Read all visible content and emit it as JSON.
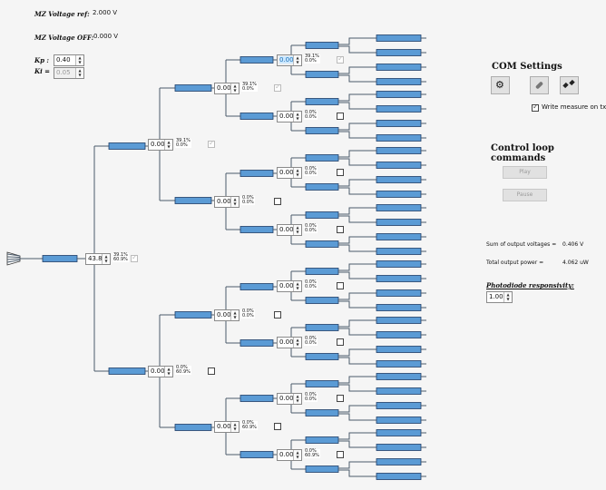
{
  "mz_ref": {
    "label": "MZ Voltage ref:",
    "value": "2.000 V"
  },
  "mz_off": {
    "label": "MZ Voltage OFF:",
    "value": "0.000 V"
  },
  "kp": {
    "label": "Kp :",
    "value": "0.40"
  },
  "ki": {
    "label": "Ki =",
    "value": "0.05"
  },
  "com": {
    "title": "COM Settings"
  },
  "write_measure": {
    "label": "Write measure on txt File",
    "checked": true
  },
  "control": {
    "title": "Control loop commands",
    "play": "Play",
    "pause": "Pause"
  },
  "sum_voltage": {
    "label": "Sum of output voltages =",
    "value": "0.406 V"
  },
  "total_power": {
    "label": "Total output power =",
    "value": "4.062 uW"
  },
  "photodiode": {
    "label": "Photodiode responsivity:",
    "value": "1.00"
  },
  "nodes": [
    {
      "value": "43.84",
      "pct_top": "39.1%",
      "pct_bot": "60.9%",
      "disabled": false,
      "checked": true,
      "cb_disabled": true
    },
    {
      "value": "0.00",
      "pct_top": "39.1%",
      "pct_bot": "0.0%",
      "disabled": false,
      "checked": true,
      "cb_disabled": true
    },
    {
      "value": "0.00",
      "pct_top": "0.0%",
      "pct_bot": "60.9%",
      "disabled": false,
      "checked": false,
      "cb_disabled": false
    },
    {
      "value": "0.00",
      "pct_top": "39.1%",
      "pct_bot": "0.0%",
      "disabled": false,
      "checked": true,
      "cb_disabled": true
    },
    {
      "value": "0.00",
      "pct_top": "0.0%",
      "pct_bot": "0.0%",
      "disabled": false,
      "checked": false,
      "cb_disabled": false
    },
    {
      "value": "0.00",
      "pct_top": "0.0%",
      "pct_bot": "0.0%",
      "disabled": false,
      "checked": false,
      "cb_disabled": false
    },
    {
      "value": "0.00",
      "pct_top": "0.0%",
      "pct_bot": "60.9%",
      "disabled": false,
      "checked": false,
      "cb_disabled": false
    },
    {
      "value": "0.00",
      "pct_top": "39.1%",
      "pct_bot": "0.0%",
      "disabled": true,
      "checked": true,
      "cb_disabled": true
    },
    {
      "value": "0.00",
      "pct_top": "0.0%",
      "pct_bot": "0.0%",
      "disabled": false,
      "checked": false,
      "cb_disabled": false
    },
    {
      "value": "0.00",
      "pct_top": "0.0%",
      "pct_bot": "0.0%",
      "disabled": false,
      "checked": false,
      "cb_disabled": false
    },
    {
      "value": "0.00",
      "pct_top": "0.0%",
      "pct_bot": "0.0%",
      "disabled": false,
      "checked": false,
      "cb_disabled": false
    },
    {
      "value": "0.00",
      "pct_top": "0.0%",
      "pct_bot": "0.0%",
      "disabled": false,
      "checked": false,
      "cb_disabled": false
    },
    {
      "value": "0.00",
      "pct_top": "0.0%",
      "pct_bot": "0.0%",
      "disabled": false,
      "checked": false,
      "cb_disabled": false
    },
    {
      "value": "0.00",
      "pct_top": "0.0%",
      "pct_bot": "0.0%",
      "disabled": false,
      "checked": false,
      "cb_disabled": false
    },
    {
      "value": "0.00",
      "pct_top": "0.0%",
      "pct_bot": "60.9%",
      "disabled": false,
      "checked": false,
      "cb_disabled": false
    }
  ],
  "colors": {
    "waveguide": "#5b9bd5",
    "waveguide_border": "#1f3d66",
    "line": "#4a5a6a"
  }
}
